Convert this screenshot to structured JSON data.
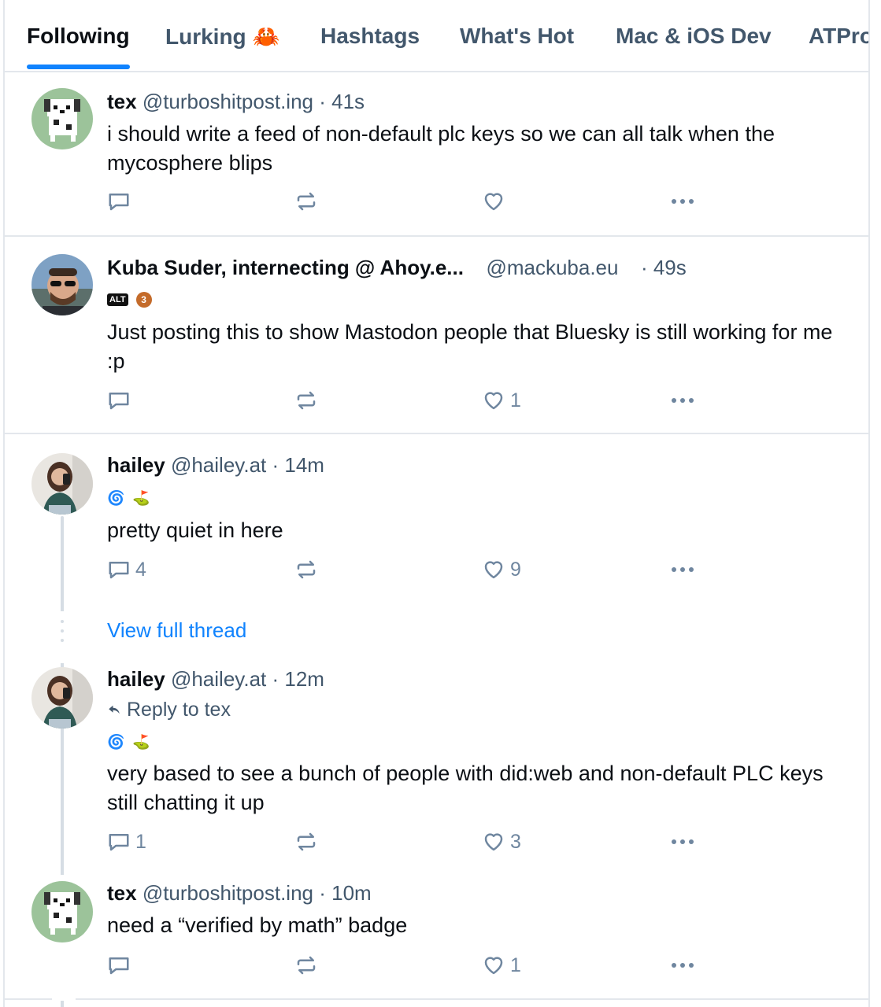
{
  "tabs": [
    {
      "label": "Following"
    },
    {
      "label": "Lurking 🦀"
    },
    {
      "label": "Hashtags"
    },
    {
      "label": "What's Hot"
    },
    {
      "label": "Mac & iOS Dev"
    },
    {
      "label": "ATPro"
    }
  ],
  "colors": {
    "accent": "#1083fe",
    "border": "#e3e7ec",
    "muted": "#42576c",
    "icon": "#6f869f"
  },
  "posts": [
    {
      "name": "tex",
      "handle": "@turboshitpost.ing",
      "time": "· 41s",
      "text": "i should write a feed of non-default plc keys so we can all talk when the mycosphere blips",
      "replies": "",
      "reposts": "",
      "likes": ""
    },
    {
      "name": "Kuba Suder, internecting @ Ahoy.e...",
      "handle": "@mackuba.eu",
      "time": "· 49s",
      "badges": [
        "ALT",
        "3"
      ],
      "text": "Just posting this to show Mastodon people that Bluesky is still working for me :p",
      "replies": "",
      "reposts": "",
      "likes": "1"
    },
    {
      "name": "hailey",
      "handle": "@hailey.at",
      "time": "· 14m",
      "badges": [
        "🌀",
        "⛳"
      ],
      "text": "pretty quiet in here",
      "replies": "4",
      "reposts": "",
      "likes": "9"
    },
    {
      "name": "hailey",
      "handle": "@hailey.at",
      "time": "· 12m",
      "reply_to": "Reply to tex",
      "badges": [
        "🌀",
        "⛳"
      ],
      "text": "very based to see a bunch of people with did:web and non-default PLC keys still chatting it up",
      "replies": "1",
      "reposts": "",
      "likes": "3"
    },
    {
      "name": "tex",
      "handle": "@turboshitpost.ing",
      "time": "· 10m",
      "text": "need a “verified by math” badge",
      "replies": "",
      "reposts": "",
      "likes": "1"
    }
  ],
  "view_full_thread": "View full thread"
}
